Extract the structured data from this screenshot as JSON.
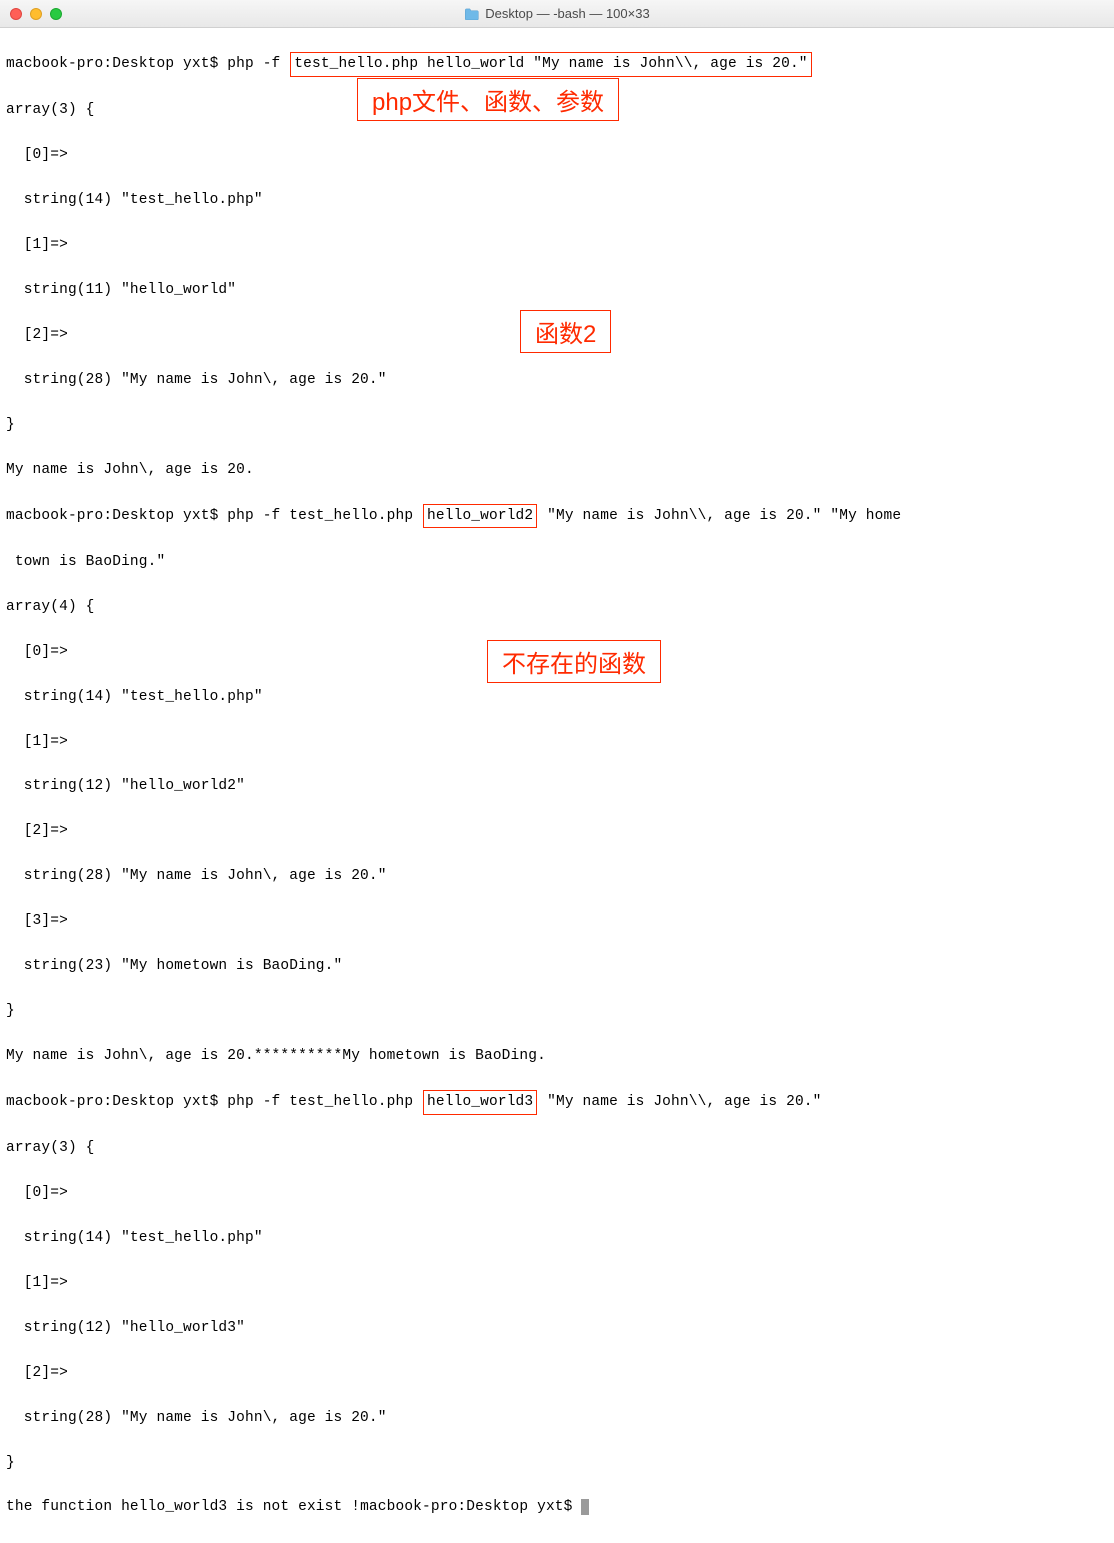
{
  "window": {
    "title": "Desktop — -bash — 100×33"
  },
  "annotations": {
    "a1": "php文件、函数、参数",
    "a2": "函数2",
    "a3": "不存在的函数"
  },
  "terminal": {
    "prompt": "macbook-pro:Desktop yxt$",
    "cmd_prefix": "php -f",
    "cmd1_boxed": "test_hello.php hello_world \"My name is John\\\\, age is 20.\"",
    "output1": {
      "l1": "array(3) {",
      "l2": "  [0]=>",
      "l3": "  string(14) \"test_hello.php\"",
      "l4": "  [1]=>",
      "l5": "  string(11) \"hello_world\"",
      "l6": "  [2]=>",
      "l7": "  string(28) \"My name is John\\, age is 20.\"",
      "l8": "}",
      "l9": "My name is John\\, age is 20."
    },
    "cmd2_part1": "php -f test_hello.php",
    "cmd2_boxed": "hello_world2",
    "cmd2_part2": " \"My name is John\\\\, age is 20.\" \"My home",
    "cmd2_cont": " town is BaoDing.\"",
    "output2": {
      "l1": "array(4) {",
      "l2": "  [0]=>",
      "l3": "  string(14) \"test_hello.php\"",
      "l4": "  [1]=>",
      "l5": "  string(12) \"hello_world2\"",
      "l6": "  [2]=>",
      "l7": "  string(28) \"My name is John\\, age is 20.\"",
      "l8": "  [3]=>",
      "l9": "  string(23) \"My hometown is BaoDing.\"",
      "l10": "}",
      "l11": "My name is John\\, age is 20.**********My hometown is BaoDing."
    },
    "cmd3_part1": "php -f test_hello.php",
    "cmd3_boxed": "hello_world3",
    "cmd3_part2": " \"My name is John\\\\, age is 20.\"",
    "output3": {
      "l1": "array(3) {",
      "l2": "  [0]=>",
      "l3": "  string(14) \"test_hello.php\"",
      "l4": "  [1]=>",
      "l5": "  string(12) \"hello_world3\"",
      "l6": "  [2]=>",
      "l7": "  string(28) \"My name is John\\, age is 20.\"",
      "l8": "}"
    },
    "final_line": "the function hello_world3 is not exist !",
    "final_prompt": "macbook-pro:Desktop yxt$ "
  }
}
